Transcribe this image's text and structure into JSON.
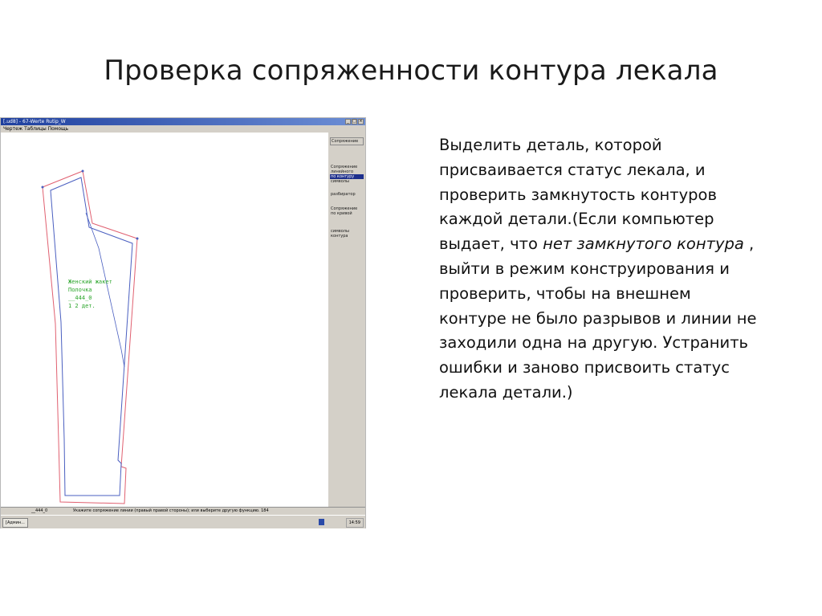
{
  "slide": {
    "title": "Проверка сопряженности контура лекала"
  },
  "screenshot": {
    "window_title": "[.ud8] - 67-Werte Rutip_W",
    "menu": "Чертеж   Таблицы   Помощь",
    "panel": {
      "btn_top": "Сопряжение",
      "group1_line1": "Сопряжение",
      "group1_line2": "линейного",
      "group1_selected": "по контуру",
      "group1_line4": "символы",
      "group2": "разбиратор",
      "group3_line1": "Сопряжение",
      "group3_line2": "по кривой",
      "group4_line1": "символы",
      "group4_line2": "контура"
    },
    "piece_label": {
      "line1": "Женский жакет",
      "line2": "Полочка",
      "line3": "__444_0",
      "line4": "1 2 дет."
    },
    "status": {
      "code": "__444_0",
      "message": "Укажите сопряжение линии (правый правой стороны); или выберите другую функцию. 184"
    },
    "taskbar": {
      "task": "[Админ...",
      "time": "14:59"
    }
  },
  "description": {
    "part1": "Выделить деталь, которой присваивается статус лекала, и проверить замкнутость контуров каждой детали.(Если компьютер выдает, что ",
    "part2": "нет замкнутого контура",
    "part3": " , выйти в режим конструирования и проверить, чтобы на внешнем контуре не было разрывов и линии не заходили одна на другую. Устранить ошибки и заново присвоить статус лекала детали.)"
  },
  "colors": {
    "outer_contour": "#e06070",
    "inner_contour": "#4a5fc0",
    "label_green": "#2aa52a"
  }
}
